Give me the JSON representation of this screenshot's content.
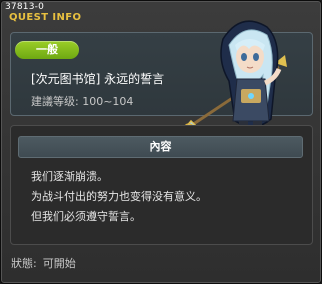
{
  "header": {
    "quest_id": "37813-0",
    "title": "QUEST INFO"
  },
  "quest": {
    "category_badge": "一般",
    "name": "[次元图书馆] 永远的誓言",
    "level_requirement": "建議等级: 100~104"
  },
  "content": {
    "header": "內容",
    "lines": [
      "我们逐渐崩溃。",
      "为战斗付出的努力也变得没有意义。",
      "但我们必须遵守誓言。"
    ]
  },
  "status": {
    "label": "狀態:",
    "value": "可開始"
  },
  "colors": {
    "title": "#e8c040",
    "badge": "#8cc21e",
    "panel": "#353f45"
  }
}
